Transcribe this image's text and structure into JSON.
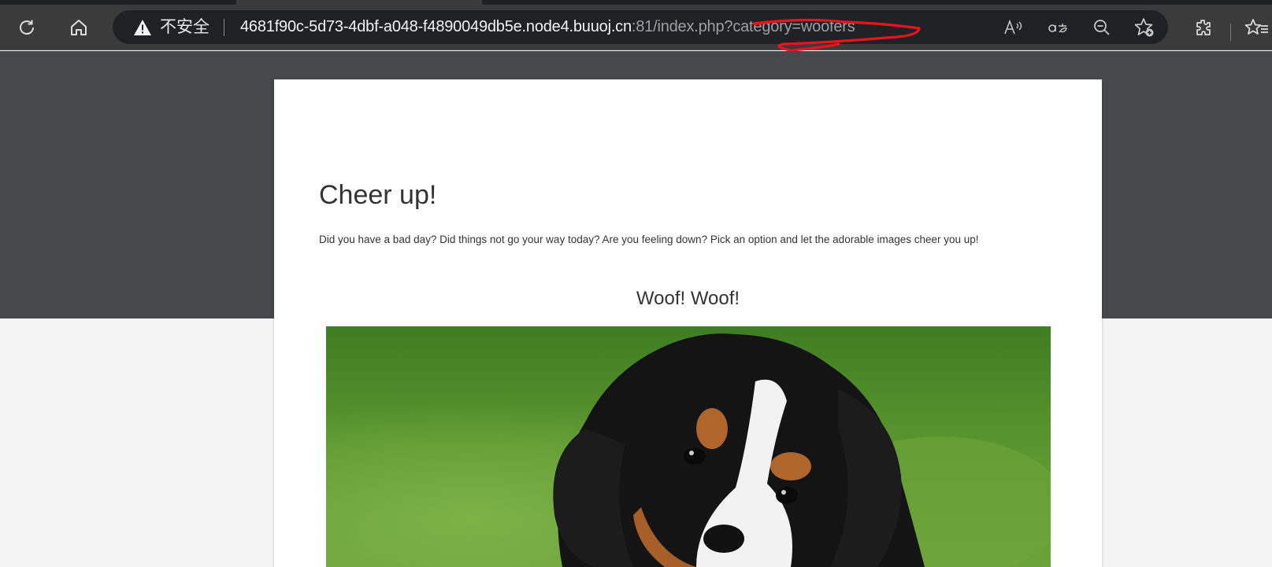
{
  "browser": {
    "security_label": "不安全",
    "url_host": "4681f90c-5d73-4dbf-a048-f4890049db5e.node4.buuoj.cn",
    "url_rest": ":81/index.php?category=woofers",
    "icons": [
      "refresh-icon",
      "home-icon",
      "warning-icon",
      "read-aloud-icon",
      "translate-icon",
      "zoom-out-icon",
      "add-favorite-icon",
      "extensions-icon",
      "favorites-icon"
    ]
  },
  "page": {
    "title": "Cheer up!",
    "description": "Did you have a bad day? Did things not go your way today? Are you feeling down? Pick an option and let the adorable images cheer you up!",
    "section_title": "Woof! Woof!"
  },
  "colors": {
    "chrome": "#3b3b3b",
    "omnibox": "#202124",
    "hero": "#47484c",
    "annotation": "#e8141b"
  }
}
